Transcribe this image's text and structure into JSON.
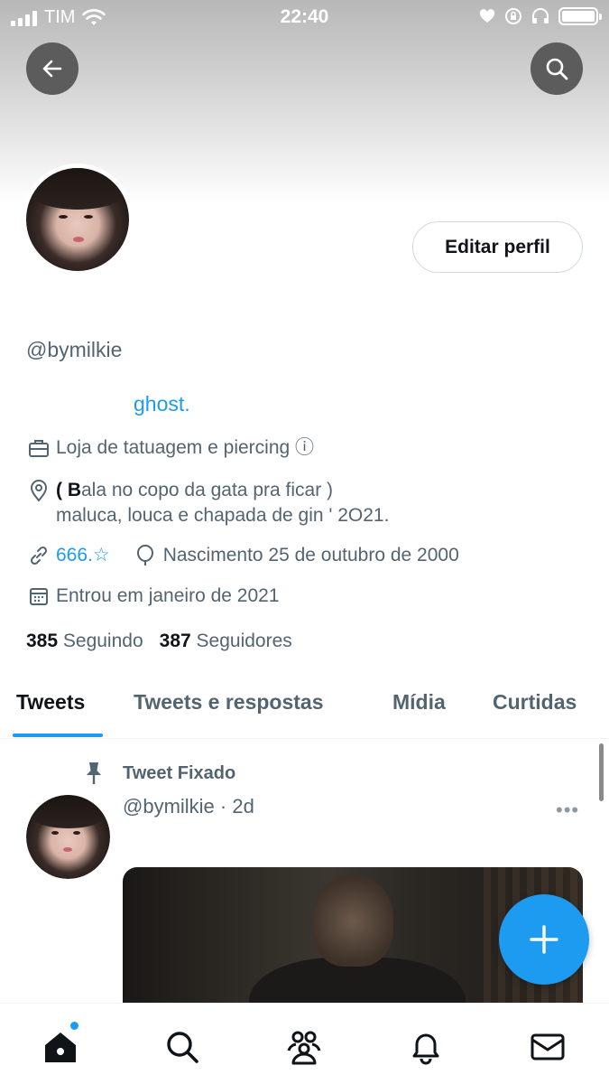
{
  "status_bar": {
    "carrier": "TIM",
    "time": "22:40"
  },
  "header": {
    "back_icon": "arrow-left-icon",
    "search_icon": "search-icon"
  },
  "profile": {
    "edit_button_label": "Editar perfil",
    "handle": "@bymilkie",
    "bio_name": "ghost.",
    "category": "Loja de tatuagem e piercing ⓘ",
    "location_bold": "( B",
    "location_line1": "ala no copo da gata pra ficar )",
    "location_line2": "maluca, louca e chapada de gin ' 2O21.",
    "link": "666.☆",
    "birth": "Nascimento 25 de outubro de 2000",
    "joined": "Entrou em janeiro de 2021",
    "following_count": "385",
    "following_label": "Seguindo",
    "followers_count": "387",
    "followers_label": "Seguidores"
  },
  "tabs": [
    {
      "label": "Tweets",
      "active": true
    },
    {
      "label": "Tweets e respostas",
      "active": false
    },
    {
      "label": "Mídia",
      "active": false
    },
    {
      "label": "Curtidas",
      "active": false
    }
  ],
  "tweet": {
    "pinned_label": "Tweet Fixado",
    "meta": "@bymilkie · 2d",
    "more": "•••"
  },
  "bottom_nav": [
    "home-icon",
    "search-icon",
    "communities-icon",
    "bell-icon",
    "mail-icon"
  ],
  "colors": {
    "accent": "#1d9bf0",
    "muted": "#536471",
    "text": "#0f1419"
  }
}
